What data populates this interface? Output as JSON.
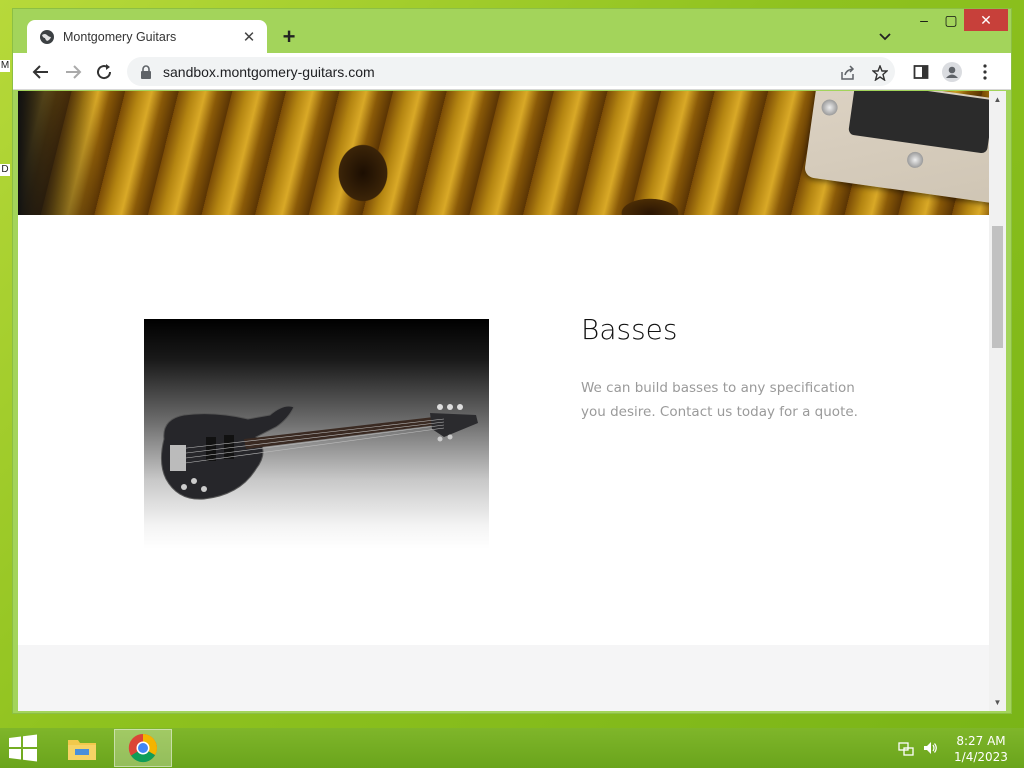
{
  "desktop": {
    "edge_glyphs": [
      "M",
      "D"
    ]
  },
  "browser": {
    "tab": {
      "title": "Montgomery Guitars",
      "icon": "globe-icon"
    },
    "address": {
      "url": "sandbox.montgomery-guitars.com"
    },
    "window_controls": {
      "minimize": "–",
      "maximize": "▢",
      "close": "✕"
    },
    "accent": "#a3d45b"
  },
  "page": {
    "section": {
      "title": "Basses",
      "text": "We can build basses to any specification you desire. Contact us today for a quote."
    }
  },
  "taskbar": {
    "items": [
      "file-explorer-icon",
      "chrome-icon"
    ],
    "clock": {
      "time": "8:27 AM",
      "date": "1/4/2023"
    }
  }
}
